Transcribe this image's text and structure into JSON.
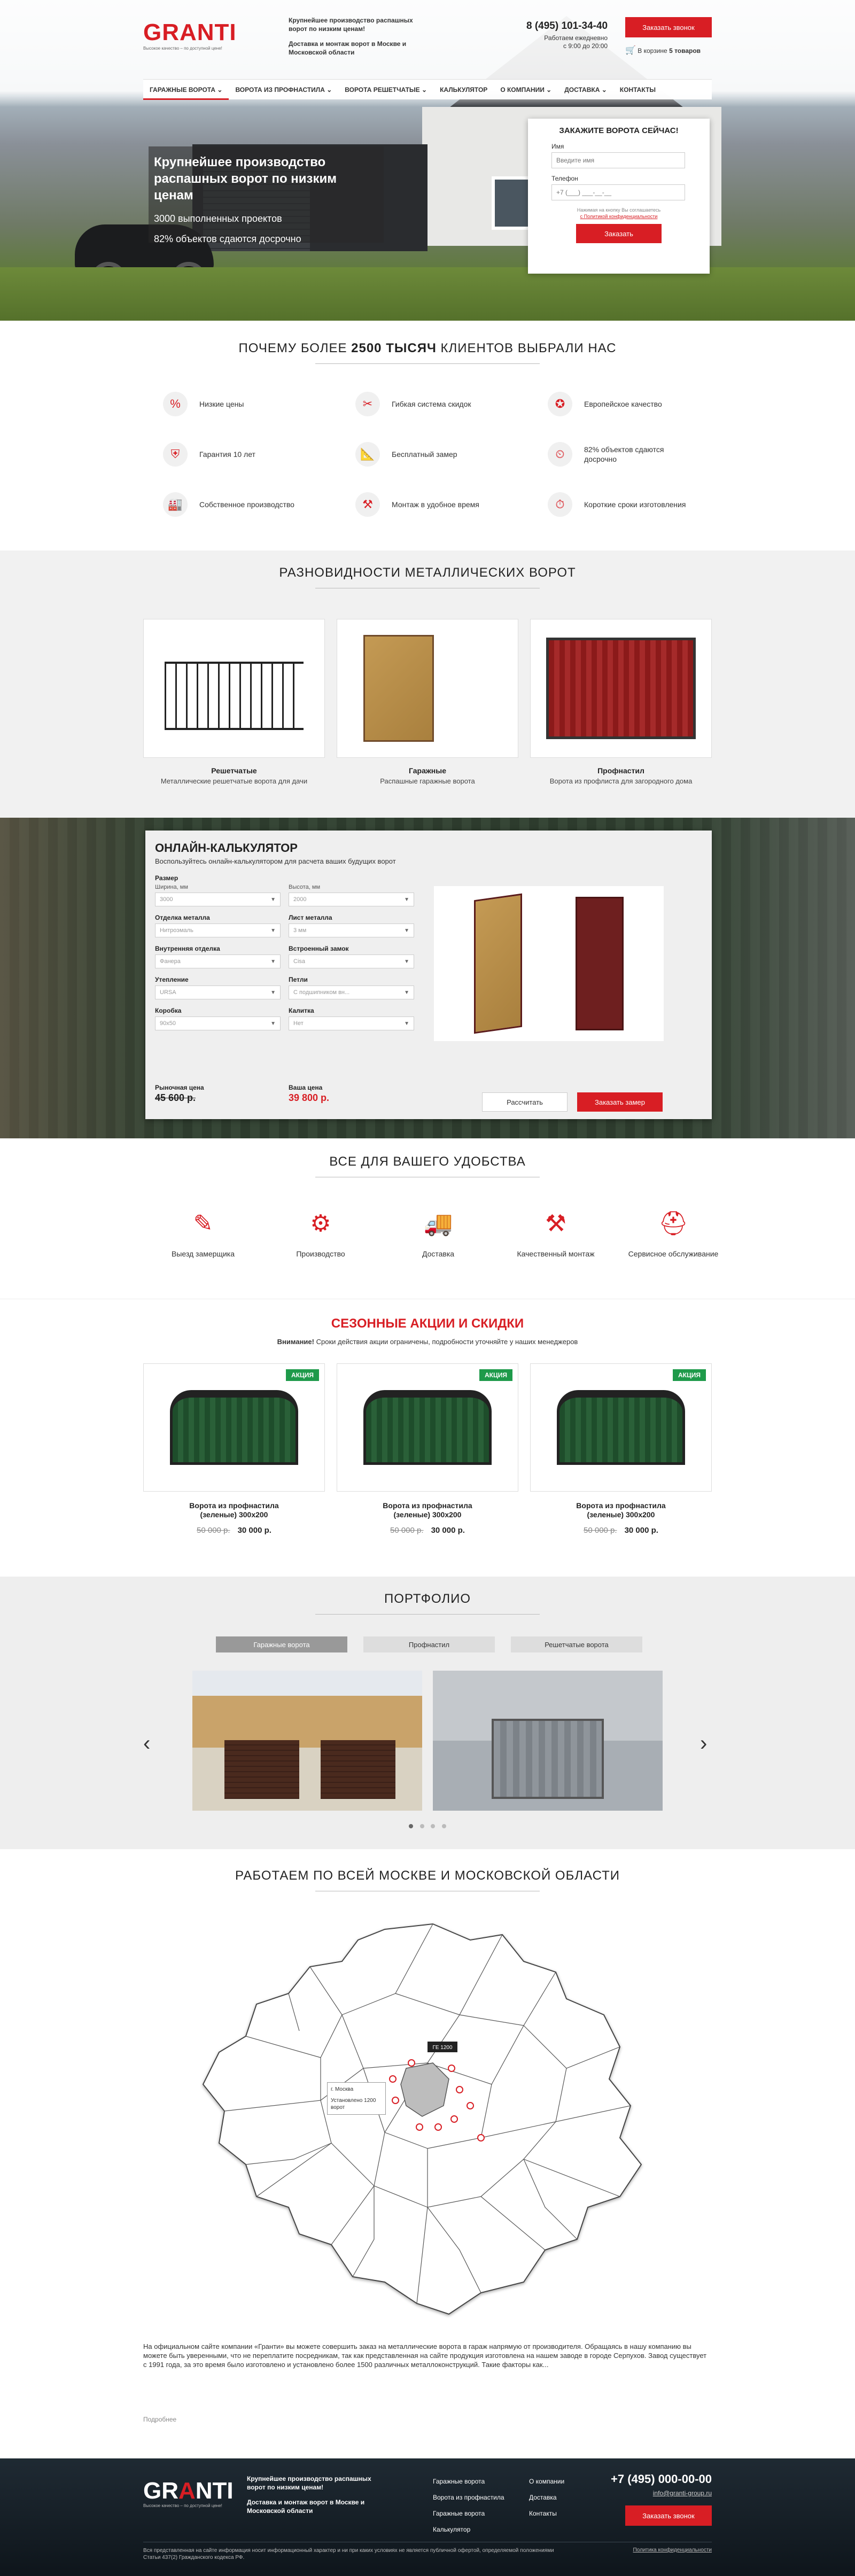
{
  "brand": {
    "logo_main": "GR",
    "logo_accent": "A",
    "logo_rest": "NTI",
    "tagline": "Высокое качество – по доступной цене!"
  },
  "header": {
    "text1": "Крупнейшее производство распашных ворот по низким ценам!",
    "text2": "Доставка и монтаж ворот в Москве и Московской области",
    "phone": "8 (495) 101-34-40",
    "hours1": "Работаем ежедневно",
    "hours2": "с 9:00 до 20:00",
    "call_button": "Заказать звонок",
    "cart_prefix": "В корзине",
    "cart_count": "5 товаров"
  },
  "nav": [
    {
      "label": "Гаражные ворота ⌄"
    },
    {
      "label": "Ворота из профнастила ⌄"
    },
    {
      "label": "Ворота решетчатые ⌄"
    },
    {
      "label": "Калькулятор"
    },
    {
      "label": "О компании ⌄"
    },
    {
      "label": "Доставка ⌄"
    },
    {
      "label": "Контакты"
    }
  ],
  "hero": {
    "title": "Крупнейшее производство распашных ворот по низким ценам",
    "stat1": "3000 выполненных проектов",
    "stat2": "82% объектов сдаются досрочно"
  },
  "order_form": {
    "title": "ЗАКАЖИТЕ ВОРОТА СЕЙЧАС!",
    "name_label": "Имя",
    "name_placeholder": "Введите имя",
    "phone_label": "Телефон",
    "phone_placeholder": "+7 (___) ___-__-__",
    "note1": "Нажимая на кнопку Вы соглашаетесь",
    "note2": "с Политикой конфиденциальности",
    "submit": "Заказать"
  },
  "why": {
    "title_prefix": "Почему более",
    "title_bold": "2500 тысяч",
    "title_suffix": "клиентов выбрали нас",
    "items": [
      {
        "icon": "percent-icon",
        "label": "Низкие цены"
      },
      {
        "icon": "tag-icon",
        "label": "Гибкая система скидок"
      },
      {
        "icon": "star-badge-icon",
        "label": "Европейское качество"
      },
      {
        "icon": "shield-icon",
        "label": "Гарантия 10 лет"
      },
      {
        "icon": "ruler-icon",
        "label": "Бесплатный замер"
      },
      {
        "icon": "truck-clock-icon",
        "label": "82% объектов сдаются досрочно"
      },
      {
        "icon": "factory-icon",
        "label": "Собственное производство"
      },
      {
        "icon": "hammer-icon",
        "label": "Монтаж в удобное время"
      },
      {
        "icon": "stopwatch-icon",
        "label": "Короткие сроки изготовления"
      }
    ]
  },
  "types": {
    "title": "Разновидности металлических ворот",
    "items": [
      {
        "name": "Решетчатые",
        "desc": "Металлические решетчатые ворота для дачи"
      },
      {
        "name": "Гаражные",
        "desc": "Распашные гаражные ворота"
      },
      {
        "name": "Профнастил",
        "desc": "Ворота из профлиста для загородного дома"
      }
    ]
  },
  "calc": {
    "title": "Онлайн-калькулятор",
    "subtitle": "Воспользуйтесь онлайн-калькулятором для расчета ваших будущих ворот",
    "size_label": "Размер",
    "width_label": "Ширина, мм",
    "width_value": "3000",
    "height_label": "Высота, мм",
    "height_value": "2000",
    "fields": [
      {
        "label": "Отделка металла",
        "value": "Нитроэмаль"
      },
      {
        "label": "Лист металла",
        "value": "3 мм"
      },
      {
        "label": "Внутренняя отделка",
        "value": "Фанера"
      },
      {
        "label": "Встроенный замок",
        "value": "Cisa"
      },
      {
        "label": "Утепление",
        "value": "URSA"
      },
      {
        "label": "Петли",
        "value": "С подшипником вн..."
      },
      {
        "label": "Коробка",
        "value": "90x50"
      },
      {
        "label": "Калитка",
        "value": "Нет"
      }
    ],
    "market_label": "Рыночная цена",
    "market_price": "45 600 р.",
    "your_label": "Ваша цена",
    "your_price": "39 800 р.",
    "calc_button": "Рассчитать",
    "order_button": "Заказать замер"
  },
  "conv": {
    "title": "Все для вашего удобства",
    "items": [
      {
        "icon": "ruler-pencil-icon",
        "label": "Выезд замерщика"
      },
      {
        "icon": "robot-arm-icon",
        "label": "Производство"
      },
      {
        "icon": "truck-icon",
        "label": "Доставка"
      },
      {
        "icon": "drill-icon",
        "label": "Качественный монтаж"
      },
      {
        "icon": "helmet-icon",
        "label": "Сервисное обслуживание"
      }
    ]
  },
  "promo": {
    "title": "Сезонные акции и скидки",
    "attention_bold": "Внимание!",
    "attention_text": "Сроки действия акции ограничены, подробности уточняйте у наших менеджеров",
    "badge": "АКЦИЯ",
    "items": [
      {
        "name1": "Ворота из профнастила",
        "name2": "(зеленые) 300х200",
        "old": "50 000 р.",
        "new": "30 000 р."
      },
      {
        "name1": "Ворота из профнастила",
        "name2": "(зеленые) 300х200",
        "old": "50 000 р.",
        "new": "30 000 р."
      },
      {
        "name1": "Ворота из профнастила",
        "name2": "(зеленые) 300х200",
        "old": "50 000 р.",
        "new": "30 000 р."
      }
    ]
  },
  "portfolio": {
    "title": "Портфолио",
    "tabs": [
      "Гаражные ворота",
      "Профнастил",
      "Решетчатые ворота"
    ],
    "prev": "‹",
    "next": "›"
  },
  "map": {
    "title": "Работаем по всей Москве и Московской области",
    "popup_city": "г. Москва",
    "popup_text": "Установлено 1200 ворот",
    "marker_label": "ГЕ 1200"
  },
  "seo": {
    "text": "На официальном сайте компании «Гранти» вы можете совершить заказ на металлические ворота в гараж напрямую от производителя. Обращаясь в нашу компанию вы можете быть уверенными, что не переплатите посредникам, так как представленная на сайте продукция изготовлена на нашем заводе в городе Серпухов. Завод существует с 1991 года, за это время было изготовлено и установлено более 1500 различных металлоконструкций. Такие факторы как...",
    "more": "Подробнее"
  },
  "footer": {
    "text1": "Крупнейшее производство распашных ворот по низким ценам!",
    "text2": "Доставка и монтаж ворот в Москве и Московской области",
    "menu1": [
      "Гаражные ворота",
      "Ворота из профнастила",
      "Гаражные ворота",
      "Калькулятор"
    ],
    "menu2": [
      "О компании",
      "Доставка",
      "Контакты"
    ],
    "phone": "+7 (495) 000-00-00",
    "email": "info@granti-group.ru",
    "call_button": "Заказать звонок",
    "copyright": "Вся представленная на сайте информация носит информационный характер и ни при каких условиях не является публичной офертой, определяемой положениями Статьи 437(2) Гражданского кодекса РФ.",
    "privacy": "Политика конфиденциальности"
  }
}
